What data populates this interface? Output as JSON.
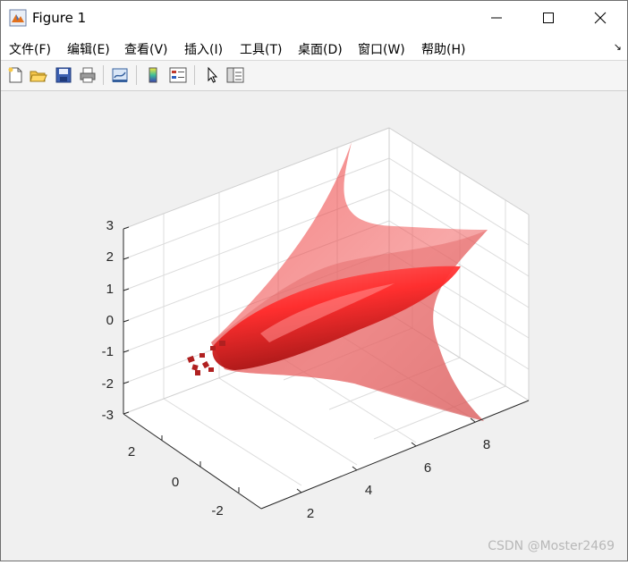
{
  "window": {
    "title": "Figure 1",
    "minimize_icon": "minimize-icon",
    "maximize_icon": "maximize-icon",
    "close_icon": "close-icon"
  },
  "menu": [
    {
      "label": "文件(F)"
    },
    {
      "label": "编辑(E)"
    },
    {
      "label": "查看(V)"
    },
    {
      "label": "插入(I)"
    },
    {
      "label": "工具(T)"
    },
    {
      "label": "桌面(D)"
    },
    {
      "label": "窗口(W)"
    },
    {
      "label": "帮助(H)"
    }
  ],
  "toolbar": [
    "new-figure-icon",
    "open-file-icon",
    "save-icon",
    "print-icon",
    "link-plot-icon",
    "colorbar-icon",
    "legend-icon",
    "edit-plot-icon",
    "property-inspector-icon"
  ],
  "axes": {
    "z_ticks": [
      "3",
      "2",
      "1",
      "0",
      "-1",
      "-2",
      "-3"
    ],
    "x_ticks": [
      "2",
      "4",
      "6",
      "8"
    ],
    "y_ticks": [
      "2",
      "0",
      "-2"
    ],
    "colors": {
      "surface": "#ff0000",
      "grid": "#dcdcdc",
      "background": "#ffffff"
    }
  },
  "watermark": "CSDN @Moster2469"
}
